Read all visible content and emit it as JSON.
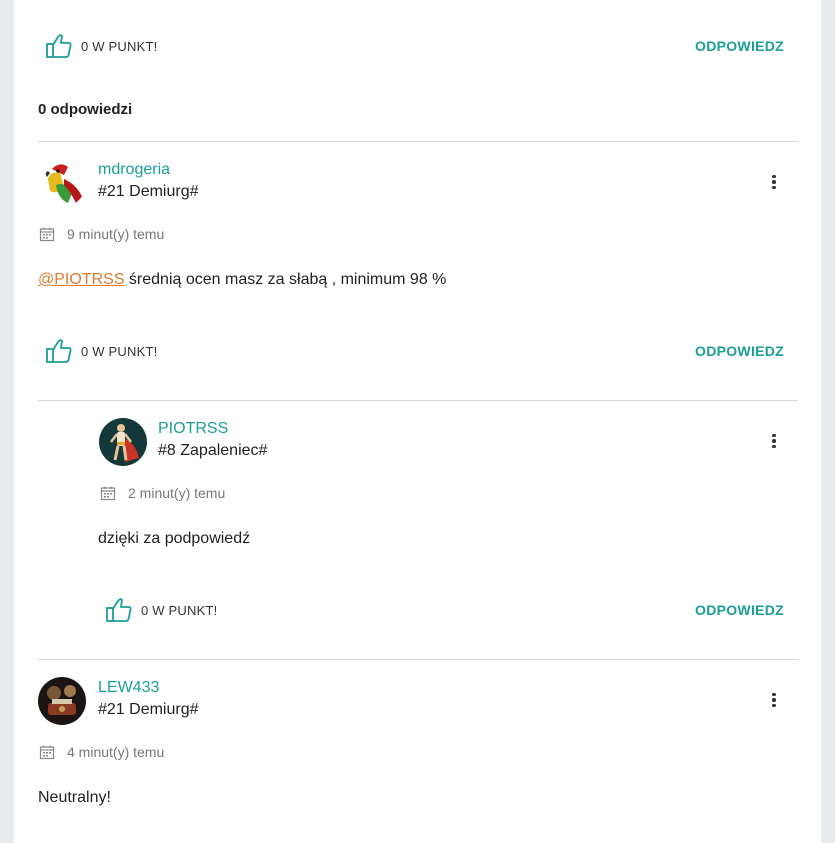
{
  "colors": {
    "accent": "#1a9e96",
    "mention": "#e07a2e"
  },
  "top_actions": {
    "like_label": "0 W PUNKT!",
    "reply_label": "ODPOWIEDZ"
  },
  "replies_count_label": "0 odpowiedzi",
  "comments": [
    {
      "username": "mdrogeria",
      "rank": "#21 Demiurg#",
      "time": "9 minut(y) temu",
      "mention": "@PIOTRSS",
      "text": " średnią ocen masz za słabą , minimum 98 %",
      "like_label": "0 W PUNKT!",
      "reply_label": "ODPOWIEDZ",
      "avatar_icon": "parrot-avatar"
    },
    {
      "username": "PIOTRSS",
      "rank": "#8 Zapaleniec#",
      "time": "2 minut(y) temu",
      "text": "dzięki za podpowiedź",
      "like_label": "0 W PUNKT!",
      "reply_label": "ODPOWIEDZ",
      "avatar_icon": "superhero-avatar"
    },
    {
      "username": "LEW433",
      "rank": "#21 Demiurg#",
      "time": "4 minut(y) temu",
      "text": "Neutralny!",
      "avatar_icon": "photo-avatar"
    }
  ]
}
